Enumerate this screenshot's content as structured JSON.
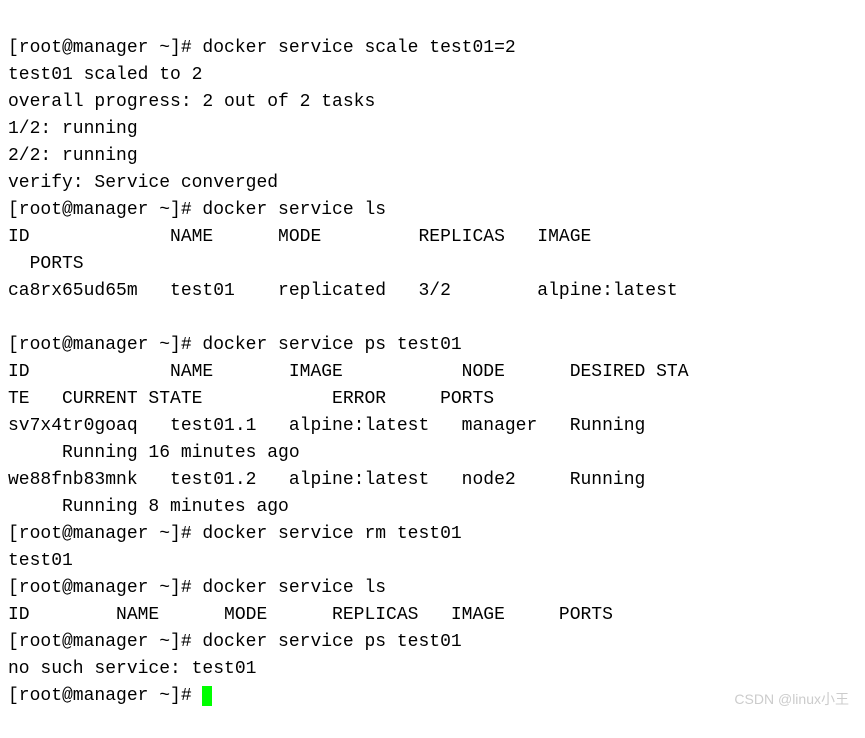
{
  "lines": [
    "[root@manager ~]# docker service scale test01=2",
    "test01 scaled to 2",
    "overall progress: 2 out of 2 tasks",
    "1/2: running",
    "2/2: running",
    "verify: Service converged",
    "[root@manager ~]# docker service ls",
    "ID             NAME      MODE         REPLICAS   IMAGE",
    "  PORTS",
    "ca8rx65ud65m   test01    replicated   3/2        alpine:latest",
    "",
    "[root@manager ~]# docker service ps test01",
    "ID             NAME       IMAGE           NODE      DESIRED STA",
    "TE   CURRENT STATE            ERROR     PORTS",
    "sv7x4tr0goaq   test01.1   alpine:latest   manager   Running",
    "     Running 16 minutes ago",
    "we88fnb83mnk   test01.2   alpine:latest   node2     Running",
    "     Running 8 minutes ago",
    "[root@manager ~]# docker service rm test01",
    "test01",
    "[root@manager ~]# docker service ls",
    "ID        NAME      MODE      REPLICAS   IMAGE     PORTS",
    "[root@manager ~]# docker service ps test01",
    "no such service: test01"
  ],
  "final_prompt": "[root@manager ~]# ",
  "watermark": "CSDN @linux小王"
}
